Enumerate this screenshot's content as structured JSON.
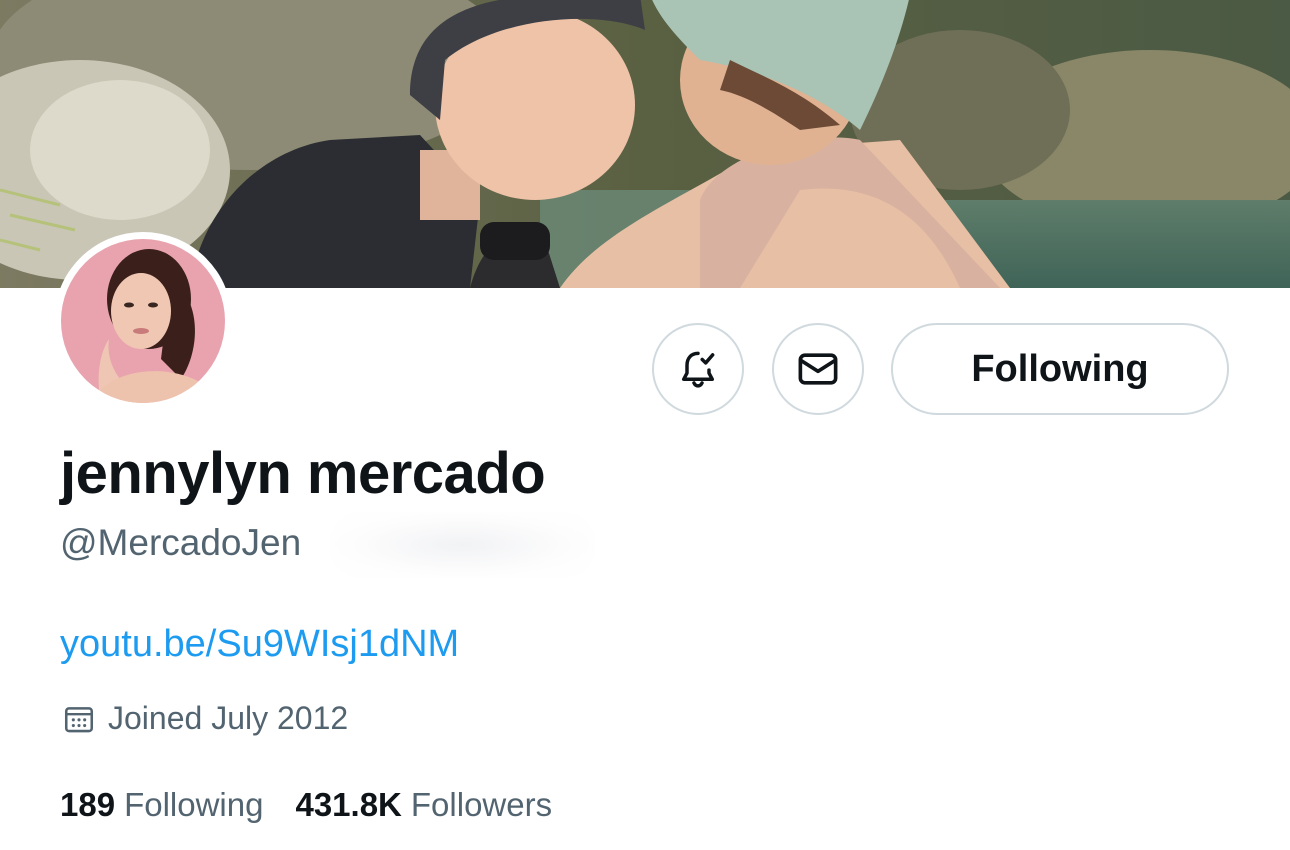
{
  "profile": {
    "display_name": "jennylyn mercado",
    "handle": "@MercadoJen",
    "link": "youtu.be/Su9WIsj1dNM",
    "joined": "Joined July 2012"
  },
  "actions": {
    "following_label": "Following",
    "notify_icon": "bell-check-icon",
    "message_icon": "envelope-icon"
  },
  "stats": {
    "following_count": "189",
    "following_label": "Following",
    "followers_count": "431.8K",
    "followers_label": "Followers"
  },
  "colors": {
    "text_primary": "#0f1419",
    "text_secondary": "#536471",
    "link": "#1d9bf0",
    "border": "#cfd9de"
  }
}
